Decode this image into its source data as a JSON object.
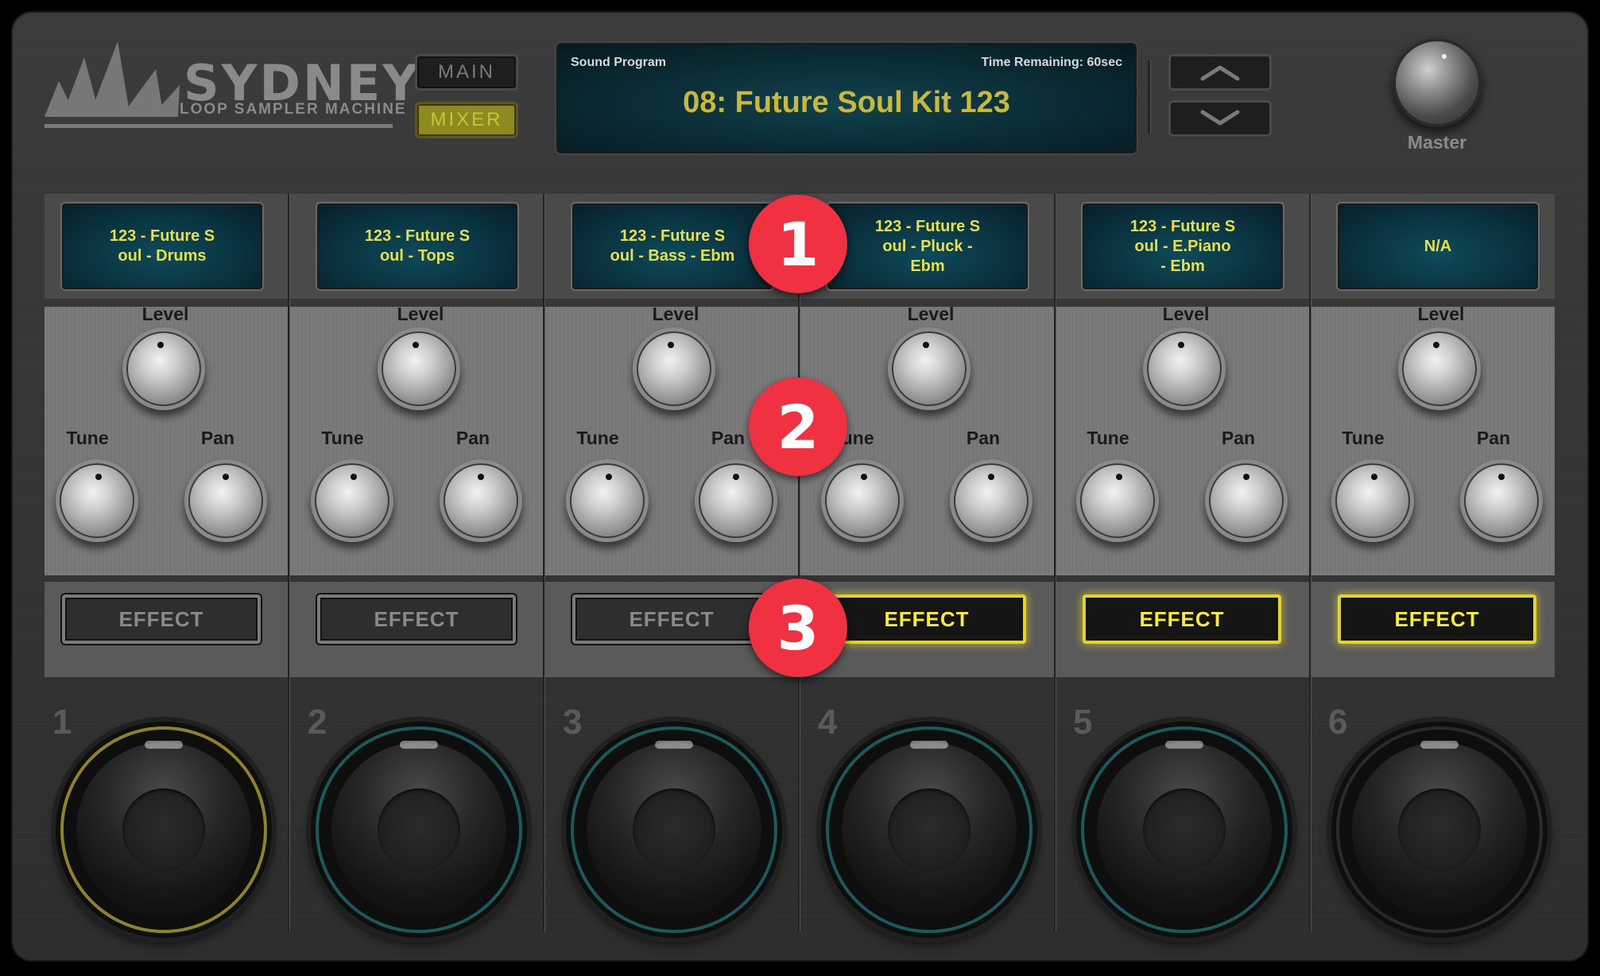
{
  "app": {
    "logo_title": "SYDNEY",
    "logo_subtitle": "LOOP SAMPLER MACHINE"
  },
  "header": {
    "main_label": "MAIN",
    "mixer_label": "MIXER",
    "display": {
      "left_label": "Sound Program",
      "right_label": "Time Remaining: 60sec",
      "program": "08: Future Soul Kit 123"
    },
    "nav_up_icon": "chevron-up-icon",
    "nav_down_icon": "chevron-down-icon",
    "master_label": "Master"
  },
  "labels": {
    "level": "Level",
    "tune": "Tune",
    "pan": "Pan"
  },
  "channels": [
    {
      "number": "1",
      "sample_lines": [
        "123 - Future S",
        "oul - Drums"
      ],
      "effect": "EFFECT",
      "effect_on": false,
      "pad_ring": "gold"
    },
    {
      "number": "2",
      "sample_lines": [
        "123 - Future S",
        "oul - Tops"
      ],
      "effect": "EFFECT",
      "effect_on": false,
      "pad_ring": "teal"
    },
    {
      "number": "3",
      "sample_lines": [
        "123 - Future S",
        "oul - Bass - Ebm"
      ],
      "effect": "EFFECT",
      "effect_on": false,
      "pad_ring": "teal"
    },
    {
      "number": "4",
      "sample_lines": [
        "123 - Future S",
        "oul - Pluck -",
        "Ebm"
      ],
      "effect": "EFFECT",
      "effect_on": true,
      "pad_ring": "teal"
    },
    {
      "number": "5",
      "sample_lines": [
        "123 - Future S",
        "oul - E.Piano",
        "- Ebm"
      ],
      "effect": "EFFECT",
      "effect_on": true,
      "pad_ring": "teal"
    },
    {
      "number": "6",
      "sample_lines": [
        "N/A"
      ],
      "effect": "EFFECT",
      "effect_on": true,
      "pad_ring": "off"
    }
  ],
  "callouts": [
    "1",
    "2",
    "3"
  ],
  "colors": {
    "lcd_text": "#e6e14a",
    "effect_on": "#f5ee36",
    "pad_ring_teal": "#1a5a5c",
    "pad_ring_gold": "#8e8328",
    "callout": "#ef3142"
  }
}
